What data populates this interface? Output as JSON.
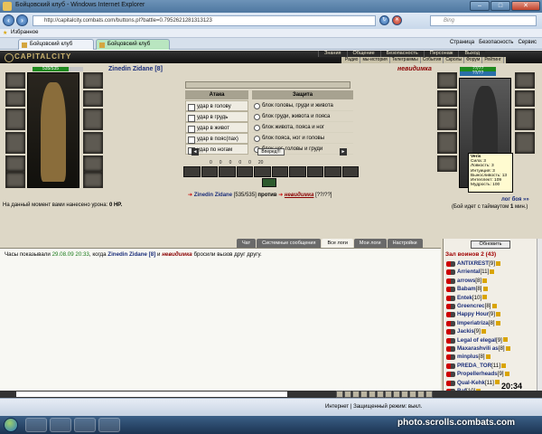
{
  "window": {
    "title": "Бойцовский клуб - Windows Internet Explorer"
  },
  "address": {
    "url": "http://capitalcity.combats.com/buttons.pl?battle=0.7952621281313123",
    "search_placeholder": "Bing"
  },
  "favorites": {
    "label": "Избранное"
  },
  "tabs": [
    {
      "label": "Бойцовский клуб"
    },
    {
      "label": "Бойцовский клуб"
    }
  ],
  "ie_toolbar": {
    "page": "Страница",
    "safety": "Безопасность",
    "service": "Сервис"
  },
  "game": {
    "logo": "CAPITALCITY",
    "top_menu": [
      "Знания",
      "Общение",
      "Безопасность",
      "Персонаж",
      "Выход"
    ],
    "sub_menu": [
      "Радио",
      "мы-история",
      "Телеграммы",
      "События",
      "Скролы",
      "Форум",
      "Рейтинг"
    ],
    "player": {
      "name": "Zinedin Zidane",
      "level": "[8]",
      "hp": "535/535"
    },
    "enemy": {
      "name": "невидимка",
      "hp_left": "??/??",
      "hp_right": "??/??"
    },
    "combat": {
      "attack_header": "Атака",
      "defense_header": "Защита",
      "attacks": [
        "удар в голову",
        "удар в грудь",
        "удар в живот",
        "удар в пояс(пах)",
        "удар по ногам"
      ],
      "defenses": [
        "блок головы, груди и живота",
        "блок груди, живота и пояса",
        "блок живота, пояса и ног",
        "блок пояса, ног и головы",
        "блок ног, головы и груди"
      ],
      "go_button": "Вперед!!!",
      "counters": [
        "0",
        "0",
        "0",
        "0",
        "0",
        "20"
      ]
    },
    "vs": {
      "player": "Zinedin Zidane",
      "player_hp": "[535/535]",
      "word": "против",
      "enemy": "невидимка",
      "enemy_hp": "[??/??]"
    },
    "damage_line": {
      "text": "На данный момент вами нанесено урона:",
      "value": "0 HP."
    },
    "fight_log_link": "лог боя »»",
    "timeout": {
      "text": "(Бой идет с таймаутом",
      "value": "1",
      "unit": "мин.)"
    },
    "tooltip": {
      "name": "Veris",
      "lines": [
        "Сила: 3",
        "Ловкость: 3",
        "Интуиция: 3",
        "Выносливость: 13",
        "Интеллект: 109",
        "Мудрость: 100"
      ]
    },
    "chat_tabs": [
      "Чат",
      "Системные сообщения",
      "Все логи",
      "Мои логи",
      "Настройки"
    ],
    "chat_message": {
      "prefix": "Часы показывали",
      "time": "29.08.09 20:33",
      "middle": ", когда",
      "user1": "Zinedin Zidane [8]",
      "and": "и",
      "user2": "невидимка",
      "suffix": "бросили вызов друг другу."
    },
    "roster": {
      "refresh_button": "Обновить",
      "title": "Зал воинов 2 (43)",
      "users": [
        {
          "name": "ANTIXREST",
          "level": "[9]"
        },
        {
          "name": "Arriental",
          "level": "[11]"
        },
        {
          "name": "arrows",
          "level": "[8]"
        },
        {
          "name": "Babam",
          "level": "[8]"
        },
        {
          "name": "Entek",
          "level": "[10]"
        },
        {
          "name": "Greencrec",
          "level": "[8]"
        },
        {
          "name": "Happy Hour",
          "level": "[9]"
        },
        {
          "name": "Imperiatriza",
          "level": "[8]"
        },
        {
          "name": "Jackis",
          "level": "[9]"
        },
        {
          "name": "Legal of elegal",
          "level": "[9]"
        },
        {
          "name": "Maxarashvili as",
          "level": "[8]"
        },
        {
          "name": "minplus",
          "level": "[8]"
        },
        {
          "name": "PREDA_TOR",
          "level": "[11]"
        },
        {
          "name": "Propellerheads",
          "level": "[9]"
        },
        {
          "name": "Qual-Kehk",
          "level": "[11]"
        },
        {
          "name": "Raf",
          "level": "[10]"
        }
      ]
    },
    "clock": "20:34"
  },
  "status": {
    "text": "Интернет | Защищенный режим: выкл."
  },
  "watermark": "photo.scrolls.combats.com"
}
